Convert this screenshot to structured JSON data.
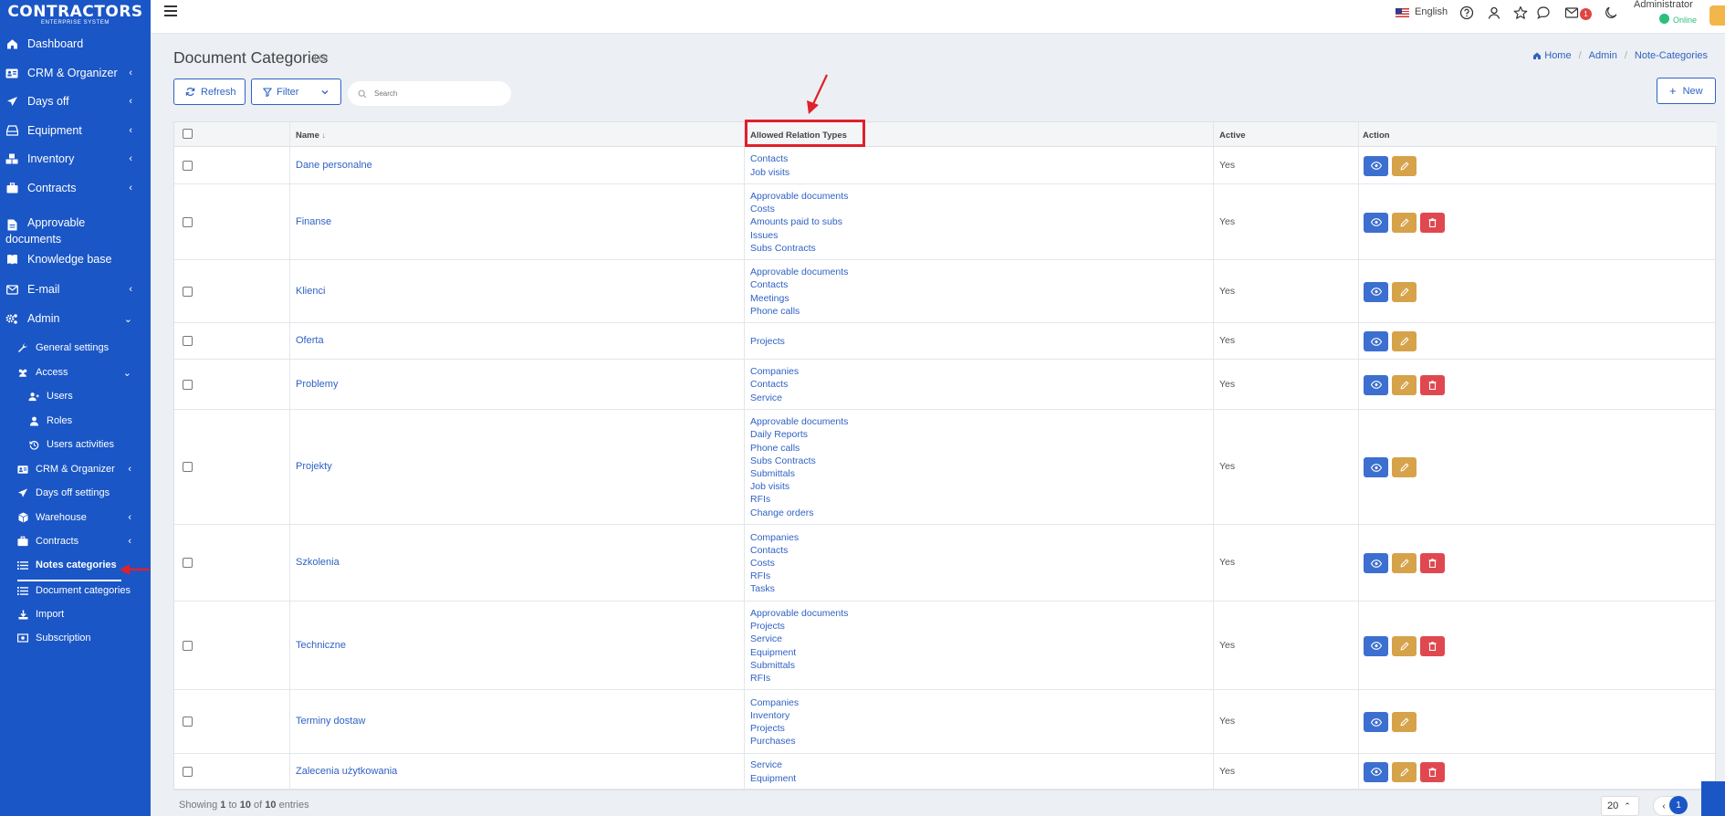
{
  "app": {
    "logo_title": "CONTRACTORS",
    "logo_subtitle": "ENTERPRISE SYSTEM"
  },
  "sidebar": {
    "items": [
      {
        "label": "Dashboard",
        "icon": "home-icon",
        "chevron": ""
      },
      {
        "label": "CRM & Organizer",
        "icon": "contact-card-icon",
        "chevron": "‹"
      },
      {
        "label": "Days off",
        "icon": "plane-icon",
        "chevron": "‹"
      },
      {
        "label": "Equipment",
        "icon": "hard-drive-icon",
        "chevron": "‹"
      },
      {
        "label": "Inventory",
        "icon": "cubes-icon",
        "chevron": "‹"
      },
      {
        "label": "Contracts",
        "icon": "briefcase-icon",
        "chevron": "‹"
      },
      {
        "label": "Approvable",
        "label2": "documents",
        "icon": "document-icon",
        "chevron": ""
      },
      {
        "label": "Knowledge base",
        "icon": "book-icon",
        "chevron": ""
      },
      {
        "label": "E-mail",
        "icon": "envelope-icon",
        "chevron": "‹"
      },
      {
        "label": "Admin",
        "icon": "gears-icon",
        "chevron": "⌄"
      }
    ],
    "admin_items": [
      {
        "label": "General settings",
        "icon": "wrench-icon",
        "chevron": ""
      },
      {
        "label": "Access",
        "icon": "users-icon",
        "chevron": "⌄"
      },
      {
        "label": "Users",
        "icon": "user-plus-icon",
        "chevron": ""
      },
      {
        "label": "Roles",
        "icon": "user-icon",
        "chevron": ""
      },
      {
        "label": "Users activities",
        "icon": "history-icon",
        "chevron": ""
      },
      {
        "label": "CRM & Organizer",
        "icon": "contact-card-icon",
        "chevron": "‹"
      },
      {
        "label": "Days off settings",
        "icon": "plane-icon",
        "chevron": ""
      },
      {
        "label": "Warehouse",
        "icon": "box-icon",
        "chevron": "‹"
      },
      {
        "label": "Contracts",
        "icon": "briefcase-icon",
        "chevron": "‹"
      },
      {
        "label": "Notes categories",
        "icon": "list-icon",
        "chevron": ""
      },
      {
        "label": "Document categories",
        "icon": "list-icon",
        "chevron": ""
      },
      {
        "label": "Import",
        "icon": "download-icon",
        "chevron": ""
      },
      {
        "label": "Subscription",
        "icon": "money-icon",
        "chevron": ""
      }
    ]
  },
  "topbar": {
    "language": "English",
    "mail_badge": "1",
    "user_name": "Administrator",
    "user_status": "Online"
  },
  "page": {
    "title": "Document Categories",
    "subtitle": "List",
    "breadcrumb": [
      "Home",
      "Admin",
      "Note-Categories"
    ]
  },
  "toolbar": {
    "refresh_label": "Refresh",
    "filter_label": "Filter",
    "search_placeholder": "Search",
    "new_label": "New"
  },
  "table": {
    "columns": [
      "Name",
      "Allowed Relation Types",
      "Active",
      "Action"
    ],
    "rows": [
      {
        "name": "Dane personalne",
        "types": [
          "Contacts",
          "Job visits"
        ],
        "active": "Yes",
        "delete": false
      },
      {
        "name": "Finanse",
        "types": [
          "Approvable documents",
          "Costs",
          "Amounts paid to subs",
          "Issues",
          "Subs Contracts"
        ],
        "active": "Yes",
        "delete": true
      },
      {
        "name": "Klienci",
        "types": [
          "Approvable documents",
          "Contacts",
          "Meetings",
          "Phone calls"
        ],
        "active": "Yes",
        "delete": false
      },
      {
        "name": "Oferta",
        "types": [
          "Projects"
        ],
        "active": "Yes",
        "delete": false
      },
      {
        "name": "Problemy",
        "types": [
          "Companies",
          "Contacts",
          "Service"
        ],
        "active": "Yes",
        "delete": true
      },
      {
        "name": "Projekty",
        "types": [
          "Approvable documents",
          "Daily Reports",
          "Phone calls",
          "Subs Contracts",
          "Submittals",
          "Job visits",
          "RFIs",
          "Change orders"
        ],
        "active": "Yes",
        "delete": false
      },
      {
        "name": "Szkolenia",
        "types": [
          "Companies",
          "Contacts",
          "Costs",
          "RFIs",
          "Tasks"
        ],
        "active": "Yes",
        "delete": true
      },
      {
        "name": "Techniczne",
        "types": [
          "Approvable documents",
          "Projects",
          "Service",
          "Equipment",
          "Submittals",
          "RFIs"
        ],
        "active": "Yes",
        "delete": true
      },
      {
        "name": "Terminy dostaw",
        "types": [
          "Companies",
          "Inventory",
          "Projects",
          "Purchases"
        ],
        "active": "Yes",
        "delete": false
      },
      {
        "name": "Zalecenia użytkowania",
        "types": [
          "Service",
          "Equipment"
        ],
        "active": "Yes",
        "delete": true
      }
    ]
  },
  "footer": {
    "showing_prefix": "Showing",
    "from": "1",
    "to_word": "to",
    "to": "10",
    "of_word": "of",
    "total": "10",
    "entries_word": "entries",
    "page_size": "20",
    "current_page": "1"
  },
  "colors": {
    "sidebar": "#1a56c6",
    "link": "#2f62c4",
    "view": "#3c6fcf",
    "edit": "#d6a24a",
    "delete": "#e0484f",
    "annotation": "#e0202a"
  }
}
